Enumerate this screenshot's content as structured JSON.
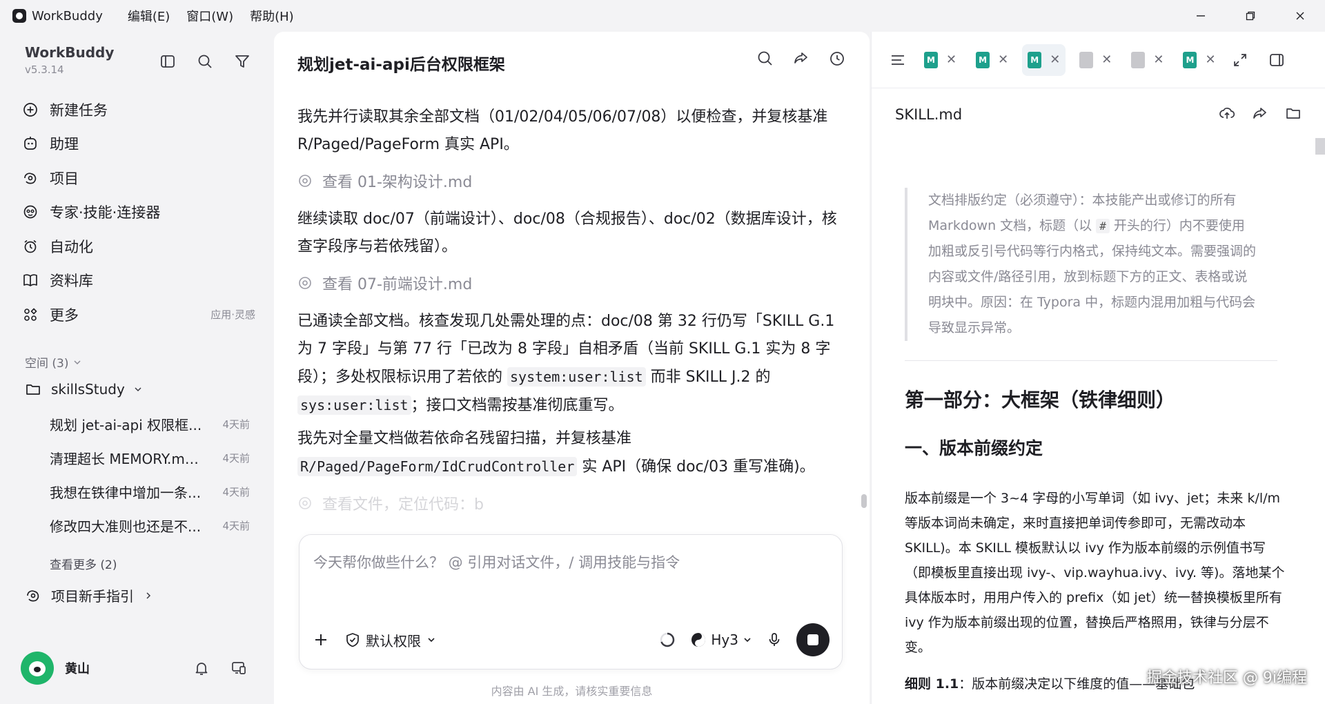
{
  "titlebar": {
    "app_name": "WorkBuddy",
    "menus": [
      "编辑(E)",
      "窗口(W)",
      "帮助(H)"
    ]
  },
  "sidebar": {
    "brand": "WorkBuddy",
    "version": "v5.3.14",
    "nav": [
      {
        "label": "新建任务",
        "icon": "plus-circle-icon"
      },
      {
        "label": "助理",
        "icon": "assistant-icon"
      },
      {
        "label": "项目",
        "icon": "project-icon"
      },
      {
        "label": "专家·技能·连接器",
        "icon": "expert-icon"
      },
      {
        "label": "自动化",
        "icon": "alarm-icon"
      },
      {
        "label": "资料库",
        "icon": "book-icon"
      },
      {
        "label": "更多",
        "icon": "grid-icon",
        "extra": "应用·灵感"
      }
    ],
    "space_label": "空间 (3)",
    "project_name": "skillsStudy",
    "conversations": [
      {
        "title": "规划 jet-ai-api 权限框...",
        "time": "4天前"
      },
      {
        "title": "清理超长 MEMORY.md ...",
        "time": "4天前"
      },
      {
        "title": "我想在铁律中增加一条...",
        "time": "4天前"
      },
      {
        "title": "修改四大准则也还是不...",
        "time": "4天前"
      }
    ],
    "see_more": "查看更多 (2)",
    "guide": "项目新手指引",
    "user_name": "黄山"
  },
  "chat": {
    "title": "规划jet-ai-api后台权限框架",
    "p1": "我先并行读取其余全部文档（01/02/04/05/06/07/08）以便检查，并复核基准 R/Paged/PageForm 真实 API。",
    "step1": "查看 01-架构设计.md",
    "p2": "继续读取 doc/07（前端设计）、doc/08（合规报告）、doc/02（数据库设计，核查字段序与若依残留）。",
    "step2": "查看 07-前端设计.md",
    "p3a": "已通读全部文档。核查发现几处需处理的点：doc/08 第 32 行仍写「SKILL G.1 为 7 字段」与第 77 行「已改为 8 字段」自相矛盾（当前 SKILL G.1 实为 8 字段）；多处权限标识用了若依的",
    "p3code1": "system:user:list",
    "p3b": "而非 SKILL J.2 的",
    "p3code2": "sys:user:list",
    "p3c": "；接口文档需按基准彻底重写。",
    "p4a": "我先对全量文档做若依命名残留扫描，并复核基准",
    "p4code": "R/Paged/PageForm/IdCrudController",
    "p4b": "实 API（确保 doc/03 重写准确)。",
    "step3": "查看文件，定位代码：b",
    "input_placeholder": "今天帮你做些什么？ @ 引用对话文件，/ 调用技能与指令",
    "permission": "默认权限",
    "model": "Hy3",
    "disclaimer": "内容由 AI 生成，请核实重要信息"
  },
  "doc": {
    "filename": "SKILL.md",
    "quote_a": "文档排版约定（必须遵守）：本技能产出或修订的所有 Markdown 文档，标题（以",
    "quote_code": "#",
    "quote_b": "开头的行）内不要使用加粗或反引号代码等行内格式，保持纯文本。需要强调的内容或文件/路径引用，放到标题下方的正文、表格或说明块中。原因：在 Typora 中，标题内混用加粗与代码会导致显示异常。",
    "h1": "第一部分：大框架（铁律细则）",
    "h2": "一、版本前缀约定",
    "para": "版本前缀是一个 3~4 字母的小写单词（如 ivy、jet；未来 k/l/m 等版本词尚未确定，来时直接把单词传参即可，无需改动本 SKILL)。本 SKILL 模板默认以 ivy 作为版本前缀的示例值书写（即模板里直接出现 ivy-、vip.wayhua.ivy、ivy. 等)。落地某个具体版本时，用用户传入的 prefix（如 jet）统一替换模板里所有 ivy 作为版本前缀出现的位置，替换后严格照用，铁律与分层不变。",
    "rule_label": "细则 1.1",
    "rule_text": "：版本前缀决定以下维度的值——基础包",
    "watermark": "掘金技术社区 @ 9i编程"
  },
  "colors": {
    "accent_green": "#1ea08c",
    "avatar_green": "#1fb56a",
    "text": "#1f1f24",
    "muted": "#8a8a94"
  }
}
